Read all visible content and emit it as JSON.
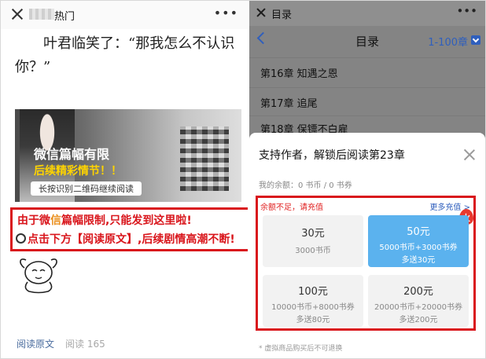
{
  "left": {
    "topbar": {
      "title": "热门"
    },
    "article_text": "叶君临笑了：“那我怎么不认识你？”",
    "promo": {
      "line1": "微信篇幅有限",
      "line2": "后续精彩情节！！",
      "line3": "长按识别二维码继续阅读"
    },
    "notice": {
      "line1_a": "由于微",
      "line1_hi": "信",
      "line1_b": "篇幅限制,只能发到这里啦!",
      "line2": "点击下方【阅读原文】,后续剧情高潮不断!"
    },
    "footer": {
      "read_original": "阅读原文",
      "read_count": "阅读 165"
    }
  },
  "right": {
    "topbar": {
      "title": "目录"
    },
    "nav": {
      "title": "目录",
      "range": "1-100章"
    },
    "chapters": [
      "第16章 知遇之恩",
      "第17章 追尾",
      "第18章 保镖不白雇"
    ],
    "sheet": {
      "title": "支持作者，解锁后阅读第23章",
      "balance": "我的余额：0 书币 / 0 书券",
      "insufficient": "余额不足，请充值",
      "more_recharge": "更多充值 >",
      "options": [
        {
          "price": "30元",
          "desc": "3000书币",
          "bonus": "",
          "selected": false
        },
        {
          "price": "50元",
          "desc": "5000书币+3000书券",
          "bonus": "多送30元",
          "selected": true
        },
        {
          "price": "100元",
          "desc": "10000书币+8000书券",
          "bonus": "多送80元",
          "selected": false
        },
        {
          "price": "200元",
          "desc": "20000书币+20000书券",
          "bonus": "多送200元",
          "selected": false
        }
      ],
      "footnote": "* 虚拟商品购买后不可退换"
    }
  },
  "colors": {
    "alert_red": "#d9161c",
    "link_blue": "#2f5fbd",
    "selected_blue": "#5bb2ee"
  },
  "icons": [
    "close-icon",
    "more-dots-icon",
    "back-arrow-icon",
    "dropdown-icon",
    "fire-icon",
    "ring-icon",
    "goat-sticker-icon"
  ]
}
